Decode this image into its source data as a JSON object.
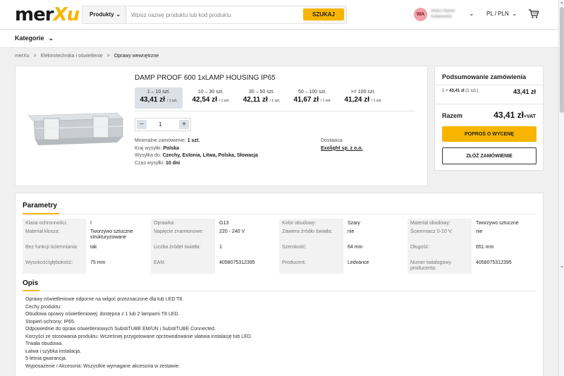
{
  "header": {
    "logo": {
      "main": "mer",
      "accent": "Xu"
    },
    "search": {
      "category": "Produkty",
      "placeholder": "Wpisz nazwę produktu lub kod produktu",
      "button": "SZUKAJ"
    },
    "user": {
      "initials": "WA",
      "name": "WIBO Marek Kołakowski"
    },
    "locale": "PL / PLN",
    "cart_icon": "cart-icon"
  },
  "nav": {
    "categories": "Kategorie"
  },
  "breadcrumb": [
    "merXu",
    "Elektrotechnika i oświetlenie",
    "Oprawy wewnętrzne"
  ],
  "product": {
    "title": "DAMP PROOF 600 1xLAMP HOUSING IP65",
    "tiers": [
      {
        "label": "1 – 10 szt.",
        "price": "43,41 zł",
        "unit": "/ 1 szt."
      },
      {
        "label": "10 – 30 szt.",
        "price": "42,54 zł",
        "unit": "/ 1 szt."
      },
      {
        "label": "30 – 50 szt.",
        "price": "42,11 zł",
        "unit": "/ 1 szt."
      },
      {
        "label": "50 – 100 szt.",
        "price": "41,67 zł",
        "unit": "/ 1 szt."
      },
      {
        "label": ">= 100 szt.",
        "price": "41,24 zł",
        "unit": "/ 1 szt."
      }
    ],
    "quantity": "1",
    "info": [
      {
        "label": "Minimalne zamówienie:",
        "value": "1 szt."
      },
      {
        "label": "Kraj wysyłki:",
        "value": "Polska"
      },
      {
        "label": "Wysyłka do:",
        "value": "Czechy, Estonia, Litwa, Polska, Słowacja"
      },
      {
        "label": "Czas wysyłki:",
        "value": "10 dni"
      }
    ],
    "supplier_label": "Dostawca",
    "supplier": "Exolight sp. z o.o."
  },
  "summary": {
    "title": "Podsumowanie zamówienia",
    "row_qty": "1 ×",
    "row_price": "43,41 zł",
    "row_unit": "(1 szt.)",
    "row_total": "43,41 zł",
    "total_label": "Razem",
    "total_value": "43,41 zł",
    "vat": "+VAT",
    "quote_button": "POPROŚ O WYCENĘ",
    "order_button": "ZŁÓŻ ZAMÓWIENIE"
  },
  "parameters": {
    "title": "Parametry",
    "rows": [
      [
        {
          "label": "Klasa ochronności:",
          "value": "I"
        },
        {
          "label": "Oprawka:",
          "value": "G13"
        },
        {
          "label": "Kolor obudowy:",
          "value": "Szary"
        },
        {
          "label": "Materiał obudowy:",
          "value": "Tworzywo sztuczne"
        }
      ],
      [
        {
          "label": "Materiał klosza:",
          "value": "Tworzywo sztuczne strukturyzowane"
        },
        {
          "label": "Napięcie znamionowe:",
          "value": "220 - 240 V"
        },
        {
          "label": "Zawiera źródło światła:",
          "value": "nie"
        },
        {
          "label": "Ściemniacz 0-10 V:",
          "value": "nie"
        }
      ],
      [
        {
          "label": "Bez funkcji ściemniania:",
          "value": "tak"
        },
        {
          "label": "Liczba źródeł światła:",
          "value": "1"
        },
        {
          "label": "Szerokość:",
          "value": "64 mm"
        },
        {
          "label": "Długość:",
          "value": "651 mm"
        }
      ],
      [
        {
          "label": "Wysokość/głębokość:",
          "value": "75 mm"
        },
        {
          "label": "EAN:",
          "value": "4058075312395"
        },
        {
          "label": "Producent:",
          "value": "Ledvance"
        },
        {
          "label": "Numer katalogowy producenta:",
          "value": "4058075312395"
        }
      ]
    ]
  },
  "description": {
    "title": "Opis",
    "lines": [
      "Oprawy oświetleniowe odporne na wilgoć przeznaczone dla tub LED T8.",
      "Cechy produktu:",
      "Obudowa oprawy oświetleniowej: dostępna z 1 lub 2 lampami T8 LED.",
      "Stopień ochrony: IP65.",
      "Odpowiednie do opraw oświetleniowych SubstiTUBE EM/UN i SubstiTUBE Connected.",
      "Korzyści ze stosowania produktu: Wcześniej przygotowane oprzewodowanie ułatwia instalację tub LED.",
      "Trwała obudowa.",
      "Łatwa i szybka instalacja.",
      "5-letnia gwarancja.",
      "Wyposażenie / Akcesoria: Wszystkie wymagane akcesoria w zestawie."
    ]
  }
}
